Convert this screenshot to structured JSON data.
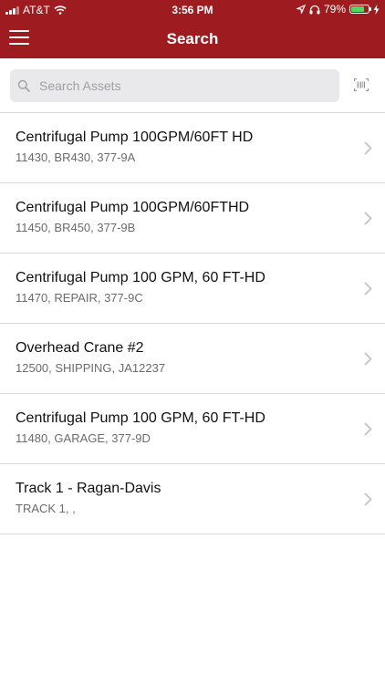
{
  "status_bar": {
    "carrier": "AT&T",
    "time": "3:56 PM",
    "battery": "79%",
    "battery_level": 0.79,
    "icons": [
      "signal-icon",
      "wifi-icon",
      "location-icon",
      "headphones-icon",
      "battery-icon",
      "charging-icon"
    ]
  },
  "nav": {
    "title": "Search",
    "menu_icon": "hamburger-menu-icon"
  },
  "search": {
    "placeholder": "Search Assets",
    "value": "",
    "icons": [
      "search-icon",
      "barcode-scan-icon"
    ]
  },
  "assets": [
    {
      "title": "Centrifugal Pump 100GPM/60FT HD",
      "subtitle": "11430, BR430, 377-9A"
    },
    {
      "title": "Centrifugal Pump 100GPM/60FTHD",
      "subtitle": "11450, BR450, 377-9B"
    },
    {
      "title": "Centrifugal Pump 100 GPM, 60 FT-HD",
      "subtitle": "11470, REPAIR, 377-9C"
    },
    {
      "title": "Overhead Crane #2",
      "subtitle": "12500, SHIPPING, JA12237"
    },
    {
      "title": "Centrifugal Pump 100 GPM, 60 FT-HD",
      "subtitle": "11480, GARAGE, 377-9D"
    },
    {
      "title": "Track 1 - Ragan-Davis",
      "subtitle": "TRACK 1, ,"
    }
  ],
  "colors": {
    "header": "#9e1c1f",
    "search_field": "#e9e9eb",
    "divider": "#d9d9d9",
    "battery": "#4cd964"
  }
}
